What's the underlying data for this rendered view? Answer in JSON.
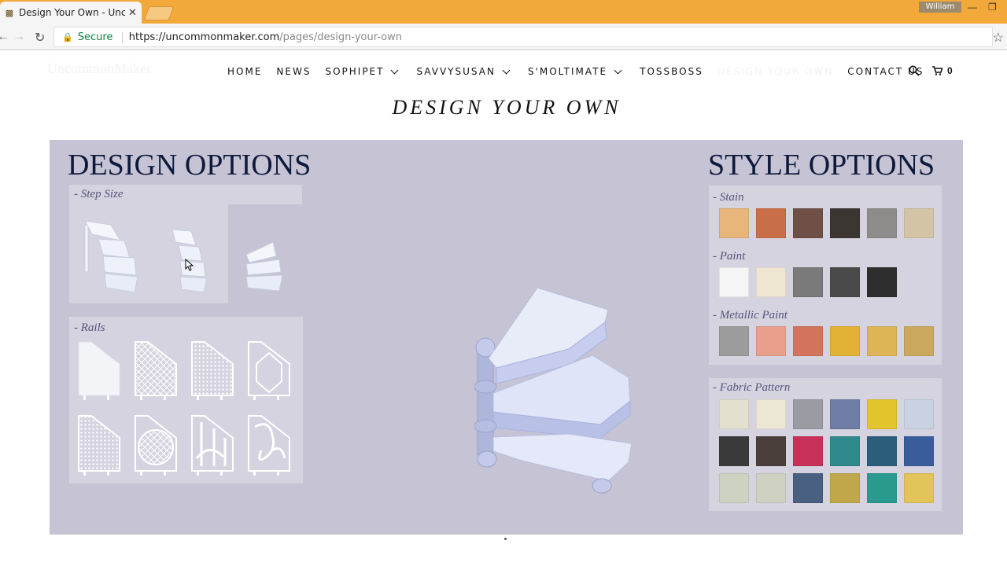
{
  "browser": {
    "tab_title": "Design Your Own - Unco",
    "user_name": "William",
    "secure_label": "Secure",
    "url_host": "https://uncommonmaker.com",
    "url_path": "/pages/design-your-own"
  },
  "site": {
    "logo_text": "UncommonMaker",
    "nav": [
      {
        "label": "HOME"
      },
      {
        "label": "NEWS"
      },
      {
        "label": "SOPHIPET"
      },
      {
        "label": "SAVVYSUSAN"
      },
      {
        "label": "S'MOLTIMATE"
      },
      {
        "label": "TOSSBOSS"
      },
      {
        "label": "DESIGN YOUR OWN"
      },
      {
        "label": "CONTACT US"
      }
    ],
    "cart_count": "0",
    "page_title": "DESIGN YOUR OWN"
  },
  "designer": {
    "design_heading": "DESIGN OPTIONS",
    "style_heading": "STYLE OPTIONS",
    "step_size_label": "- Step Size",
    "rails_label": "- Rails",
    "stain_label": "- Stain",
    "paint_label": "- Paint",
    "metallic_label": "- Metallic Paint",
    "fabric_label": "- Fabric Pattern",
    "colors": {
      "stain": [
        "#e8b57a",
        "#c86e48",
        "#6e5046",
        "#3c3632",
        "#8e8c8a",
        "#d4c4a6"
      ],
      "paint": [
        "#f5f5f5",
        "#efe6d2",
        "#7a7a7a",
        "#4a4a4a",
        "#2e2e2e"
      ],
      "metallic": [
        "#9c9c9c",
        "#e8a08c",
        "#d2745c",
        "#e2b236",
        "#ddb456",
        "#caa95e"
      ],
      "fabric": [
        [
          "#e4e0d0",
          "#ece6d4",
          "#9a9aa2",
          "#6e7ca6",
          "#e2c42c",
          "#c8d2e2"
        ],
        [
          "#3a3a3a",
          "#4a3e3a",
          "#c8325a",
          "#2e8a8a",
          "#2a5e7a",
          "#3a5c9a"
        ],
        [
          "#cdd2c2",
          "#cfd2c2",
          "#4a6080",
          "#c0a84a",
          "#2a9a8e",
          "#e2c45a"
        ]
      ],
      "accent_heading": "#0e1a3c",
      "panel_bg": "#c6c4d4"
    }
  }
}
